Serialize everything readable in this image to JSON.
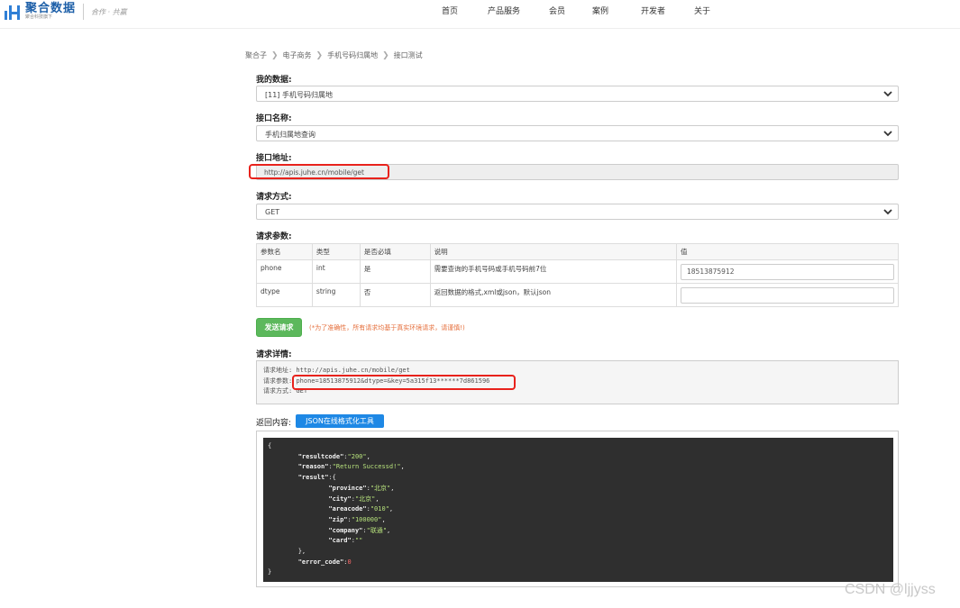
{
  "header": {
    "logo_text": "聚合数据",
    "logo_sub": "聚合科技旗下",
    "slogan": "合作 · 共赢",
    "nav": [
      "首页",
      "产品服务",
      "会员",
      "案例",
      "开发者",
      "关于"
    ]
  },
  "breadcrumb": [
    "聚合子",
    "电子商务",
    "手机号码归属地",
    "接口测试"
  ],
  "form": {
    "my_data_label": "我的数据:",
    "my_data_value": "[11] 手机号码归属地",
    "api_name_label": "接口名称:",
    "api_name_value": "手机归属地查询",
    "api_url_label": "接口地址:",
    "api_url_value": "http://apis.juhe.cn/mobile/get",
    "method_label": "请求方式:",
    "method_value": "GET",
    "params_label": "请求参数:"
  },
  "params_table": {
    "headers": [
      "参数名",
      "类型",
      "是否必填",
      "说明",
      "值"
    ],
    "rows": [
      {
        "name": "phone",
        "type": "int",
        "required": "是",
        "desc": "需要查询的手机号码或手机号码前7位",
        "value": "18513875912"
      },
      {
        "name": "dtype",
        "type": "string",
        "required": "否",
        "desc": "返回数据的格式,xml或json，默认json",
        "value": ""
      }
    ]
  },
  "send_button": "发送请求",
  "send_note": "(*为了准确性，所有请求均基于真实环境请求，请谨慎!)",
  "details": {
    "label": "请求详情:",
    "url_line": "请求地址: http://apis.juhe.cn/mobile/get",
    "params_prefix": "请求参数:",
    "params_value": "phone=18513875912&dtype=&key=5a315f13******7d861596",
    "method_line": "请求方式: GET"
  },
  "response": {
    "label": "返回内容:",
    "json_tool_button": "JSON在线格式化工具",
    "resultcode": "200",
    "reason": "Return Successd!",
    "province": "北京",
    "city": "北京",
    "areacode": "010",
    "zip": "100000",
    "company": "联通",
    "card": "",
    "error_code": "0"
  },
  "watermark": "CSDN @ljjyss",
  "colors": {
    "accent": "#1e88e5",
    "send": "#5cb85c",
    "highlight": "#e8221c"
  }
}
